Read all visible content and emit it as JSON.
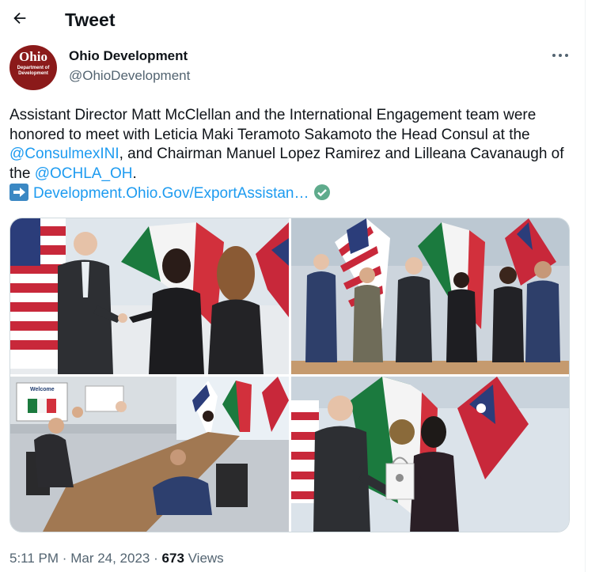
{
  "header": {
    "title": "Tweet",
    "back_icon": "arrow-left-icon"
  },
  "author": {
    "name": "Ohio Development",
    "handle": "@OhioDevelopment",
    "avatar_logo": "Ohio",
    "avatar_sub1": "Department of",
    "avatar_sub2": "Development",
    "avatar_color": "#8b1a1a"
  },
  "more_icon": "more-horizontal-icon",
  "tweet": {
    "text_part1": "Assistant Director Matt McClellan and the International Engagement team were honored to meet with Leticia Maki Teramoto Sakamoto the Head Consul at the ",
    "mention1": "@ConsulmexINI",
    "text_part2": ", and Chairman Manuel Lopez Ramirez and Lilleana Cavanaugh of the ",
    "mention2": "@OCHLA_OH",
    "text_part3": ".",
    "arrow_emoji": "arrow-right-emoji",
    "link": "Development.Ohio.Gov/ExportAssistan…",
    "check_emoji": "check-mark-emoji",
    "link_color": "#1d9bf0"
  },
  "media": {
    "photos": [
      {
        "label": "photo-handshake"
      },
      {
        "label": "photo-group-portrait"
      },
      {
        "label": "photo-conference-room"
      },
      {
        "label": "photo-gift-exchange"
      }
    ],
    "welcome_slide": "Welcome"
  },
  "footer": {
    "time": "5:11 PM",
    "separator": "·",
    "date": "Mar 24, 2023",
    "views_count": "673",
    "views_label": "Views"
  }
}
